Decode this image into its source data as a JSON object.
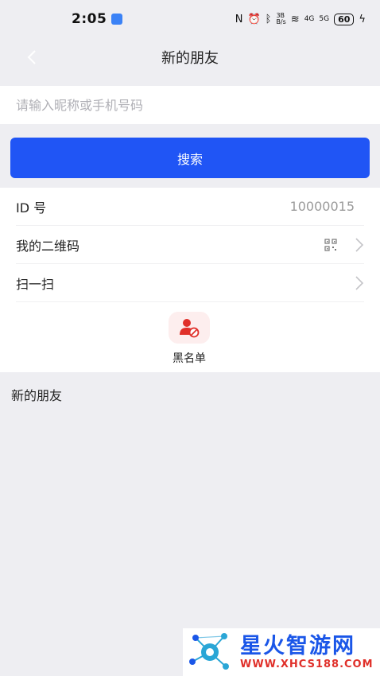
{
  "status_bar": {
    "time": "2:05",
    "network_speed": "3B\nB/s",
    "signal_1": "4G",
    "signal_2": "5G",
    "battery": "60"
  },
  "nav": {
    "title": "新的朋友"
  },
  "search": {
    "placeholder": "请输入昵称或手机号码",
    "value": "",
    "button_label": "搜索"
  },
  "list": {
    "id_label": "ID 号",
    "id_value": "10000015",
    "qr_label": "我的二维码",
    "scan_label": "扫一扫"
  },
  "blacklist": {
    "label": "黑名单"
  },
  "section": {
    "title": "新的朋友"
  },
  "watermark": {
    "title": "星火智游网",
    "url": "WWW.XHCS188.COM"
  },
  "colors": {
    "accent": "#2055f5",
    "danger": "#e0302a",
    "background": "#eeeef2"
  }
}
